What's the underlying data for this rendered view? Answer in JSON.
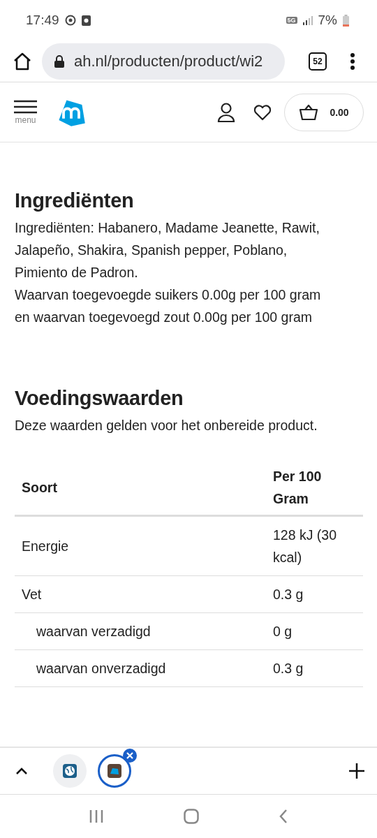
{
  "status_bar": {
    "time": "17:49",
    "network": "5G",
    "battery": "7%"
  },
  "browser": {
    "url": "ah.nl/producten/product/wi2",
    "tab_count": "52"
  },
  "site_header": {
    "menu_label": "menu",
    "cart_total": "0.00"
  },
  "ingredients": {
    "heading": "Ingrediënten",
    "paragraphs": [
      "Ingrediënten: Habanero, Madame Jeanette, Rawit, Jalapeño, Shakira, Spanish pepper, Poblano, Pimiento de Padron.",
      "Waarvan toegevoegde suikers 0.00g per 100 gram en waarvan toegevoegd zout 0.00g per 100 gram"
    ]
  },
  "nutrition": {
    "heading": "Voedingswaarden",
    "intro": "Deze waarden gelden voor het onbereide product.",
    "table": {
      "columns": [
        "Soort",
        "Per 100 Gram"
      ],
      "rows": [
        {
          "name": "Energie",
          "value": "128 kJ (30 kcal)",
          "sub": false
        },
        {
          "name": "Vet",
          "value": "0.3 g",
          "sub": false
        },
        {
          "name": "waarvan verzadigd",
          "value": "0 g",
          "sub": true
        },
        {
          "name": "waarvan onverzadigd",
          "value": "0.3 g",
          "sub": true
        }
      ]
    }
  },
  "tab_strip": {
    "tabs": [
      {
        "kind": "globe",
        "selected": false
      },
      {
        "kind": "logo",
        "selected": true
      }
    ]
  }
}
